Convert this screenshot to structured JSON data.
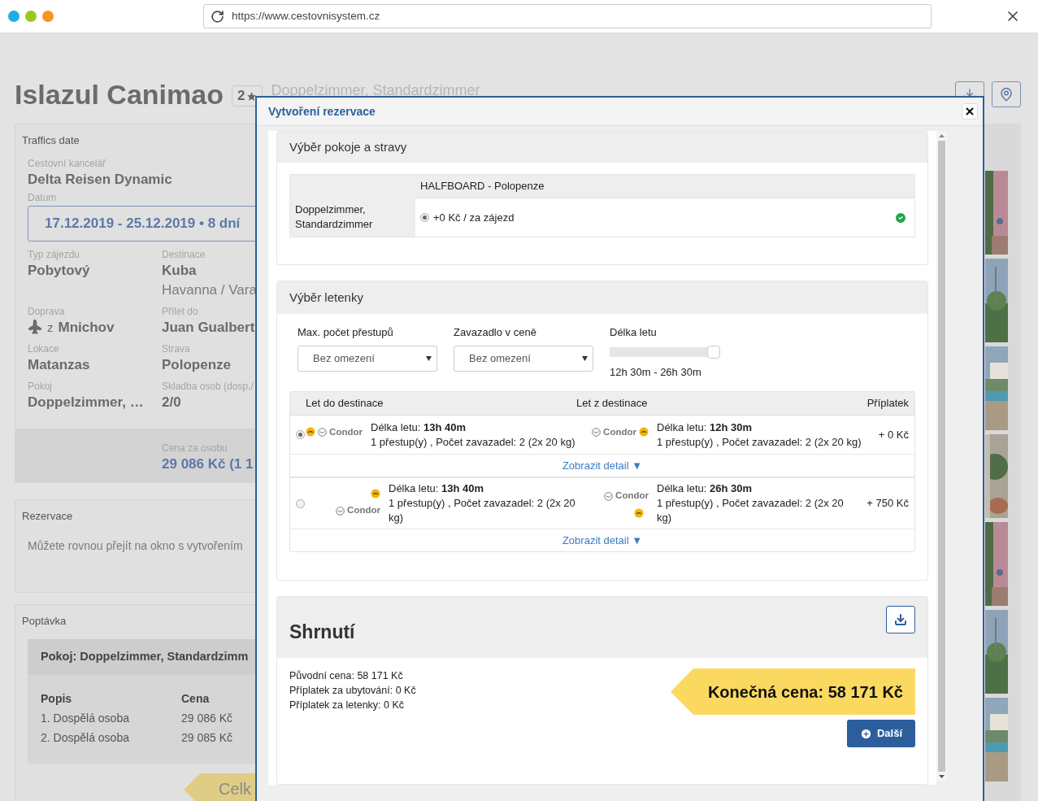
{
  "browser": {
    "url": "https://www.cestovnisystem.cz"
  },
  "hotel": {
    "name": "Islazul Canimao",
    "rating": "2",
    "subtitle": "Doppelzimmer, Standardzimmer"
  },
  "details_panel": {
    "title": "Traffics date",
    "agency": {
      "label": "Cestovní kancelář",
      "value": "Delta Reisen Dynamic"
    },
    "date": {
      "label": "Datum",
      "value": "17.12.2019 - 25.12.2019 • 8 dní"
    },
    "fields": [
      {
        "kind": "text",
        "label": "Typ zájezdu",
        "value": "Pobytový"
      },
      {
        "kind": "text",
        "label": "Destinace",
        "value": "Kuba",
        "detail": "Havanna / Vara"
      },
      {
        "kind": "transport",
        "label": "Doprava",
        "prefix": "z",
        "value": "Mnichov"
      },
      {
        "kind": "text",
        "label": "Přílet do",
        "value": "Juan Gualbert"
      },
      {
        "kind": "text",
        "label": "Lokace",
        "value": "Matanzas"
      },
      {
        "kind": "text",
        "label": "Strava",
        "value": "Polopenze"
      },
      {
        "kind": "text",
        "label": "Pokoj",
        "value": "Doppelzimmer, …"
      },
      {
        "kind": "text",
        "label": "Skladba osob (dosp./",
        "value": "2/0"
      }
    ],
    "price": {
      "label": "Cena za osobu",
      "value": "29 086 Kč (1 1"
    }
  },
  "reservation_panel": {
    "title": "Rezervace",
    "text": "Můžete rovnou přejít na okno s vytvořením"
  },
  "inquiry_panel": {
    "title": "Poptávka",
    "room": "Pokoj: Doppelzimmer, Standardzimm",
    "columns": [
      "Popis",
      "Cena"
    ],
    "rows": [
      [
        "1. Dospělá osoba",
        "29 086 Kč"
      ],
      [
        "2. Dospělá osoba",
        "29 085 Kč"
      ]
    ],
    "total": "Celk"
  },
  "modal": {
    "title": "Vytvoření rezervace",
    "room_section": {
      "title": "Výběr pokoje a stravy",
      "board": "HALFBOARD - Polopenze",
      "room": "Doppelzimmer, Standardzimmer",
      "option": {
        "label": "+0 Kč / za zájezd",
        "selected": true,
        "confirmed": true
      }
    },
    "flight_section": {
      "title": "Výběr letenky",
      "filters": [
        {
          "kind": "select",
          "label": "Max. počet přestupů",
          "value": "Bez omezení"
        },
        {
          "kind": "select",
          "label": "Zavazadlo v ceně",
          "value": "Bez omezení"
        },
        {
          "kind": "range",
          "label": "Délka letu",
          "level": 1,
          "reading": "12h 30m - 26h 30m"
        }
      ],
      "columns": [
        "Let do destinace",
        "Let z destinace",
        "Příplatek"
      ],
      "flights": [
        {
          "selected": true,
          "kind": "inline",
          "outbound": {
            "airline": "Condor",
            "duration": "Délka letu: **13h 40m**",
            "info": "1 přestup(y) , Počet zavazadel: 2 (2x 20 kg)"
          },
          "return": {
            "airline": "Condor",
            "duration": "Délka letu: **12h 30m**",
            "info": "1 přestup(y) , Počet zavazadel: 2 (2x 20 kg)"
          },
          "surcharge": "+ 0 Kč",
          "detail_link": "Zobrazit detail ▼"
        },
        {
          "selected": false,
          "kind": "stacked",
          "outbound": {
            "airline": "Condor",
            "duration": "Délka letu: **13h 40m**",
            "info": "1 přestup(y) , Počet zavazadel: 2 (2x 20 kg)"
          },
          "return": {
            "airline": "Condor",
            "duration": "Délka letu: **26h 30m**",
            "info": "1 přestup(y) , Počet zavazadel: 2 (2x 20 kg)"
          },
          "surcharge": "+ 750 Kč",
          "detail_link": "Zobrazit detail ▼"
        }
      ]
    },
    "summary": {
      "title": "Shrnutí",
      "lines": [
        "Původní cena: 58 171 Kč",
        "Příplatek za ubytování: 0 Kč",
        "Příplatek za letenky: 0 Kč"
      ],
      "total": "Konečná cena: 58 171 Kč",
      "next_button": "Další"
    }
  }
}
